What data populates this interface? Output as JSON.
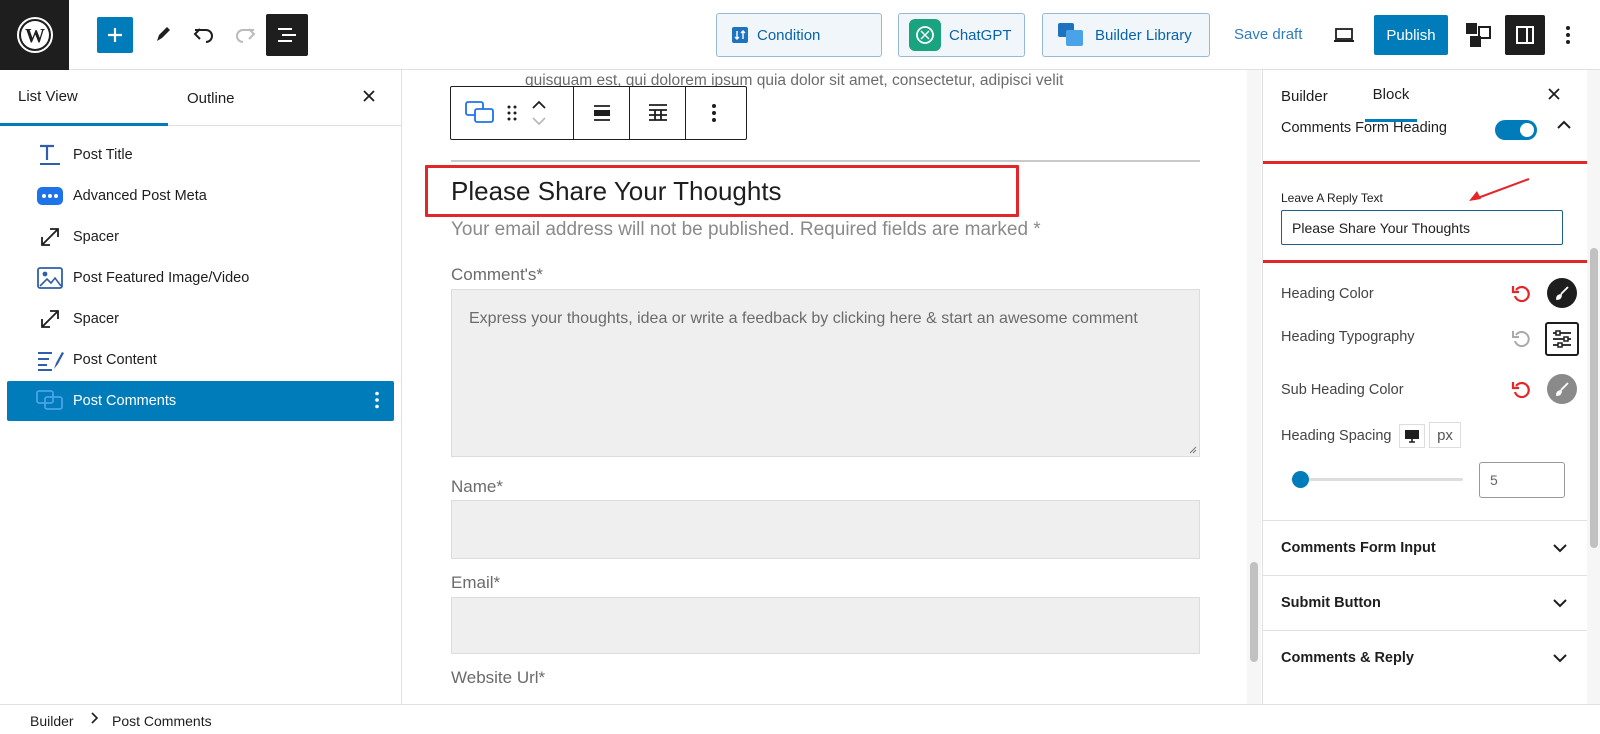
{
  "topbar": {
    "condition_label": "Condition",
    "chatgpt_label": "ChatGPT",
    "builder_library_label": "Builder Library",
    "save_draft_label": "Save draft",
    "publish_label": "Publish",
    "accent_color": "#007cba"
  },
  "left_panel": {
    "tabs": [
      {
        "label": "List View",
        "active": true
      },
      {
        "label": "Outline",
        "active": false
      }
    ],
    "items": [
      {
        "label": "Post Title",
        "icon": "title-icon"
      },
      {
        "label": "Advanced Post Meta",
        "icon": "meta-dots-icon"
      },
      {
        "label": "Spacer",
        "icon": "resize-arrow-icon"
      },
      {
        "label": "Post Featured Image/Video",
        "icon": "image-icon"
      },
      {
        "label": "Spacer",
        "icon": "resize-arrow-icon"
      },
      {
        "label": "Post Content",
        "icon": "content-edit-icon"
      },
      {
        "label": "Post Comments",
        "icon": "comments-icon",
        "selected": true
      }
    ]
  },
  "canvas": {
    "top_text": "quisquam est, qui dolorem ipsum quia dolor sit amet, consectetur, adipisci velit",
    "heading": "Please Share Your Thoughts",
    "subheading": "Your email address will not be published. Required fields are marked *",
    "comment_label": "Comment's*",
    "comment_placeholder": "Express your thoughts, idea or write a feedback by clicking here & start an awesome comment",
    "name_label": "Name*",
    "email_label": "Email*",
    "website_label": "Website Url*",
    "highlight_color": "#e3262a"
  },
  "right_panel": {
    "tabs": [
      {
        "label": "Builder",
        "active": false
      },
      {
        "label": "Block",
        "active": true
      }
    ],
    "section_title": "Comments Form Heading",
    "toggle_on": true,
    "leave_reply_label": "Leave A Reply Text",
    "leave_reply_value": "Please Share Your Thoughts",
    "heading_color_label": "Heading Color",
    "heading_typography_label": "Heading Typography",
    "sub_heading_color_label": "Sub Heading Color",
    "heading_spacing_label": "Heading Spacing",
    "unit": "px",
    "spacing_value": "5",
    "spacing_slider_fraction": 0.05,
    "accordions": [
      {
        "label": "Comments Form Input"
      },
      {
        "label": "Submit Button"
      },
      {
        "label": "Comments & Reply"
      }
    ]
  },
  "footer": {
    "breadcrumb_root": "Builder",
    "breadcrumb_current": "Post Comments"
  }
}
